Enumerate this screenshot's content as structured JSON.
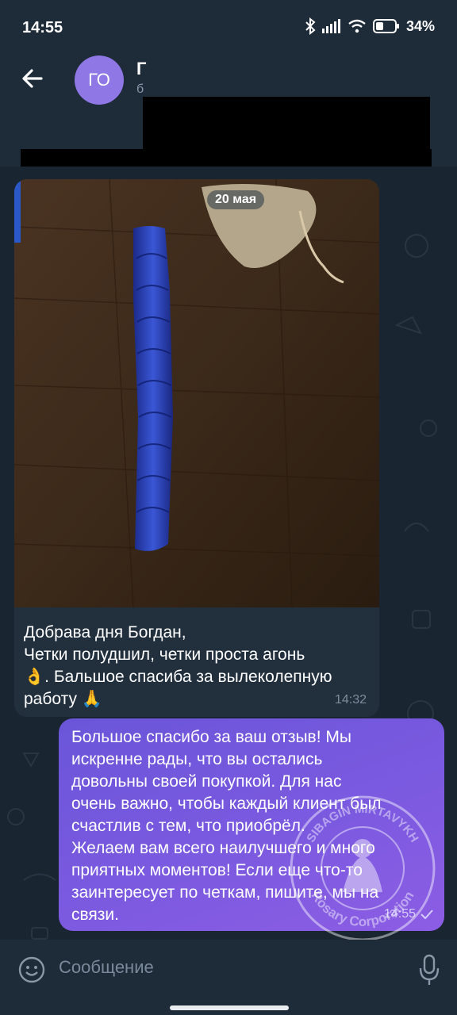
{
  "status": {
    "time": "14:55",
    "battery": "34%"
  },
  "header": {
    "avatar_initials": "ГО",
    "name_initial": "Г",
    "subtitle_initial": "б"
  },
  "messages": {
    "date": "20 мая",
    "incoming": {
      "text_lines": [
        "Добрава дня Богдан,",
        "Четки полудшил, четки проста агонь",
        "👌. Бальшое спасиба за вылеколепную",
        "работу 🙏"
      ],
      "time": "14:32"
    },
    "outgoing": {
      "text_lines": [
        "Большое спасибо за ваш отзыв! Мы",
        "искренне рады, что вы остались",
        "довольны своей покупкой. Для нас",
        "очень важно, чтобы каждый клиент был",
        "счастлив с тем, что приобрёл.",
        "Желаем вам всего наилучшего и много",
        "приятных моментов! Если еще что-то",
        "заинтересует по четкам, пишите, мы на",
        "связи."
      ],
      "time": "14:55"
    }
  },
  "watermark": {
    "top_text": "SIBAGIN MIRTAVYKH",
    "bottom_text": "Rosary Corporation"
  },
  "composer": {
    "placeholder": "Сообщение"
  },
  "icons": {
    "back": "arrow-left-icon",
    "emoji": "smile-icon",
    "mic": "microphone-icon",
    "check": "check-icon"
  },
  "colors": {
    "accent": "#7b5ae0",
    "avatar": "#8f78e6",
    "link": "#4c9ce2"
  }
}
